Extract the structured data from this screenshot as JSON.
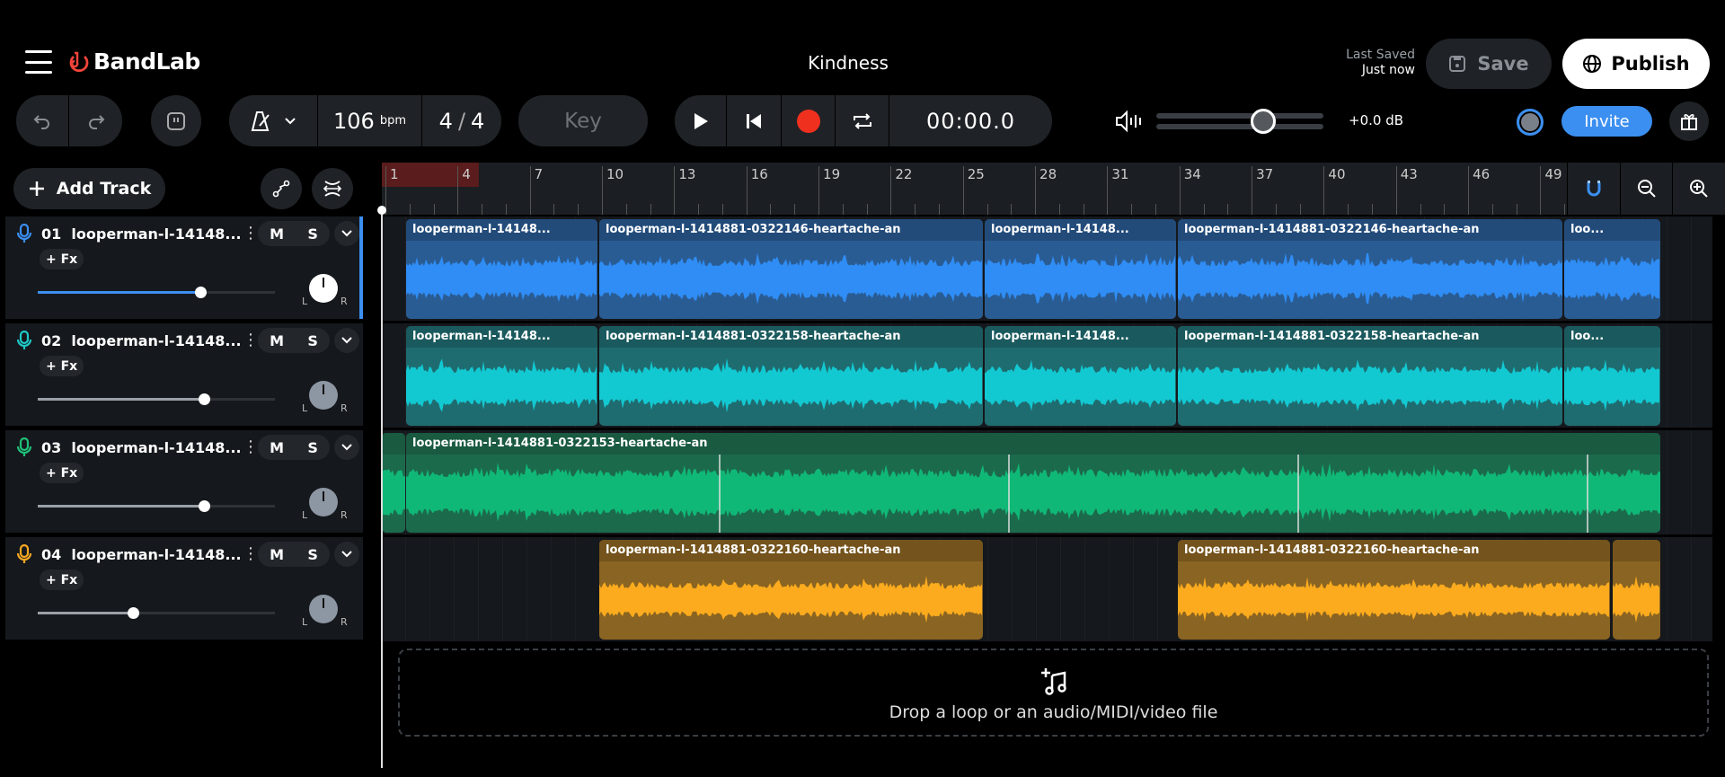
{
  "app": {
    "name": "BandLab",
    "project_title": "Kindness",
    "brand_color": "#f0443a"
  },
  "header": {
    "last_saved_label": "Last Saved",
    "last_saved_value": "Just now",
    "save_label": "Save",
    "publish_label": "Publish",
    "invite_label": "Invite"
  },
  "toolbar": {
    "tempo": "106",
    "tempo_unit": "bpm",
    "time_sig_num": "4",
    "time_sig_den": "4",
    "key_label": "Key",
    "time": "00:00.0",
    "master_volume_fraction": 0.64,
    "master_volume_db": "+0.0 dB",
    "record_color": "#f0301f"
  },
  "left": {
    "add_track_label": "Add Track"
  },
  "ruler": {
    "bars": [
      "1",
      "4",
      "7",
      "10",
      "13",
      "16",
      "19",
      "22",
      "25",
      "28",
      "31",
      "34",
      "37",
      "40",
      "43",
      "46",
      "49"
    ]
  },
  "tracks": [
    {
      "number": "01",
      "name": "looperman-l-14148...",
      "mute": "M",
      "solo": "S",
      "fx": "+ Fx",
      "volume": 0.685,
      "pan": "C",
      "pan_L": "L",
      "pan_R": "R",
      "color": "#3b8ff0",
      "clip_bg": "#2a5c94",
      "clip_hdr": "#224b7a",
      "wave": "#2f8df5",
      "selected": true,
      "clips": [
        "looperman-l-14148...",
        "looperman-l-1414881-0322146-heartache-an",
        "looperman-l-14148...",
        "looperman-l-1414881-0322146-heartache-an",
        "loo..."
      ]
    },
    {
      "number": "02",
      "name": "looperman-l-14148...",
      "mute": "M",
      "solo": "S",
      "fx": "+ Fx",
      "volume": 0.7,
      "pan": "C",
      "pan_L": "L",
      "pan_R": "R",
      "color": "#1ec8c8",
      "clip_bg": "#1f6c70",
      "clip_hdr": "#1a5a5e",
      "wave": "#12c9d2",
      "selected": false,
      "clips": [
        "looperman-l-14148...",
        "looperman-l-1414881-0322158-heartache-an",
        "looperman-l-14148...",
        "looperman-l-1414881-0322158-heartache-an",
        "loo..."
      ]
    },
    {
      "number": "03",
      "name": "looperman-l-14148...",
      "mute": "M",
      "solo": "S",
      "fx": "+ Fx",
      "volume": 0.7,
      "pan": "C",
      "pan_L": "L",
      "pan_R": "R",
      "color": "#1fbf78",
      "clip_bg": "#1c6a4c",
      "clip_hdr": "#195a41",
      "wave": "#10b877",
      "selected": false,
      "clips": [
        "",
        "looperman-l-1414881-0322153-heartache-an"
      ]
    },
    {
      "number": "04",
      "name": "looperman-l-14148...",
      "mute": "M",
      "solo": "S",
      "fx": "+ Fx",
      "volume": 0.4,
      "pan": "C",
      "pan_L": "L",
      "pan_R": "R",
      "color": "#f7a823",
      "clip_bg": "#8a6422",
      "clip_hdr": "#74531c",
      "wave": "#fbab1d",
      "selected": false,
      "clips": [
        "looperman-l-1414881-0322160-heartache-an",
        "looperman-l-1414881-0322160-heartache-an",
        ""
      ]
    }
  ],
  "dropzone": {
    "text": "Drop a loop or an audio/MIDI/video file"
  }
}
